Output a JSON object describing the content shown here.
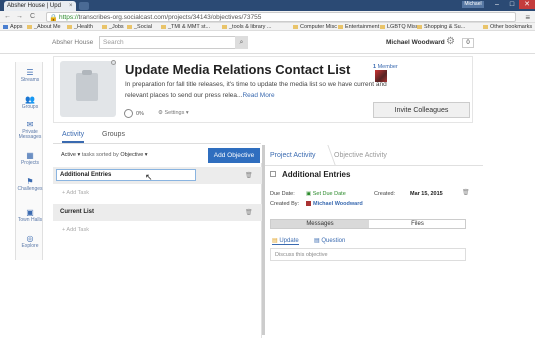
{
  "browser": {
    "tab_title": "Absher House | Upd",
    "tab_close": "×",
    "user_badge": "Michael",
    "min": "–",
    "max": "□",
    "close": "✕",
    "back": "←",
    "forward": "→",
    "reload": "C",
    "url_scheme": "https://",
    "url_host": "transcribes-org.socialcast.com",
    "url_path": "/projects/34143/objectives/73755",
    "menu": "≡"
  },
  "bookmarks": [
    {
      "label": "Apps"
    },
    {
      "label": "_About Me"
    },
    {
      "label": "_Health"
    },
    {
      "label": "_Jobs"
    },
    {
      "label": "_Social"
    },
    {
      "label": "_TMI & MMT st..."
    },
    {
      "label": "_tools & library ..."
    },
    {
      "label": "Computer Misc"
    },
    {
      "label": "Entertainment"
    },
    {
      "label": "LGBTQ Misc"
    },
    {
      "label": "Shopping & Su..."
    },
    {
      "label": "Other bookmarks"
    }
  ],
  "topbar": {
    "brand": "Absher House",
    "search_placeholder": "Search",
    "search_icon": "search-icon",
    "user_name": "Michael Woodward",
    "gear": "⚙",
    "count": "0"
  },
  "leftnav": [
    {
      "label": "Streams",
      "icon": "☰"
    },
    {
      "label": "Groups",
      "icon": "👥"
    },
    {
      "label": "Private Messages",
      "icon": "✉"
    },
    {
      "label": "Projects",
      "icon": "▦"
    },
    {
      "label": "Challenges",
      "icon": "⚑"
    },
    {
      "label": "Town Halls",
      "icon": "▣"
    },
    {
      "label": "Explore",
      "icon": "◎"
    }
  ],
  "project": {
    "title": "Update Media Relations Contact List",
    "description": "In preparation for fall title releases, it's time to update the media list so we have current and relevant places to send our press relea...",
    "read_more": "Read More",
    "progress_pct": "0%",
    "settings_label": "Settings ▾",
    "members_count": "1",
    "members_label": "Member",
    "invite_label": "Invite Colleagues"
  },
  "tabs": {
    "activity": "Activity",
    "groups": "Groups"
  },
  "filter": {
    "status": "Active ▾",
    "sorted_by": "tasks sorted by",
    "sort_value": "Objective ▾"
  },
  "add_objective": "Add Objective",
  "lists": [
    {
      "name": "Additional Entries",
      "add_task": "+ Add Task"
    },
    {
      "name": "Current List",
      "add_task": "+ Add Task"
    }
  ],
  "detail": {
    "crumb_active": "Project Activity",
    "crumb": "Objective Activity",
    "title": "Additional Entries",
    "due_label": "Due Date:",
    "due_value": "Set Due Date",
    "created_label": "Created:",
    "created_value": "Mar 15, 2015",
    "created_by_label": "Created By:",
    "created_by_value": "Michael Woodward",
    "tab_messages": "Messages",
    "tab_files": "Files",
    "update": "Update",
    "question": "Question",
    "discuss_placeholder": "Discuss this objective"
  }
}
